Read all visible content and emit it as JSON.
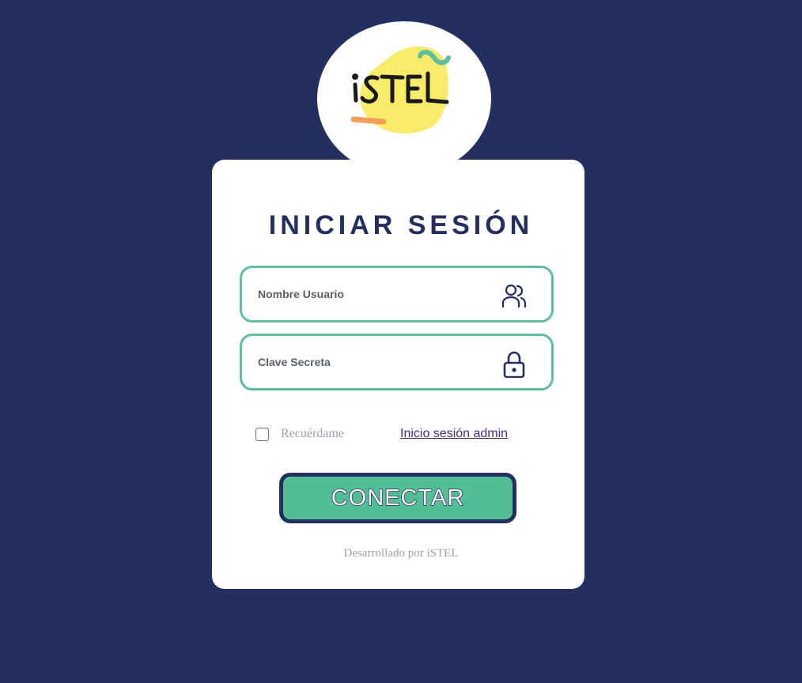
{
  "logo": {
    "text": "iSTEL",
    "blob_color": "#f7ec6a",
    "accent_teal": "#5fbf9c",
    "accent_orange": "#f0a05a"
  },
  "login": {
    "title": "INICIAR SESIÓN",
    "username": {
      "placeholder": "Nombre Usuario",
      "value": "",
      "icon": "users-icon"
    },
    "password": {
      "placeholder": "Clave Secreta",
      "value": "",
      "icon": "lock-icon"
    },
    "remember_label": "Recuérdame",
    "remember_checked": false,
    "admin_link": "Inicio sesión admin",
    "submit_label": "CONECTAR",
    "footer": "Desarrollado por iSTEL"
  },
  "colors": {
    "background": "#232f5e",
    "card": "#ffffff",
    "field_border": "#5fbf9c",
    "button": "#54bd96",
    "button_border": "#232f5e",
    "title": "#232f5e",
    "link": "#4b2a7a"
  }
}
